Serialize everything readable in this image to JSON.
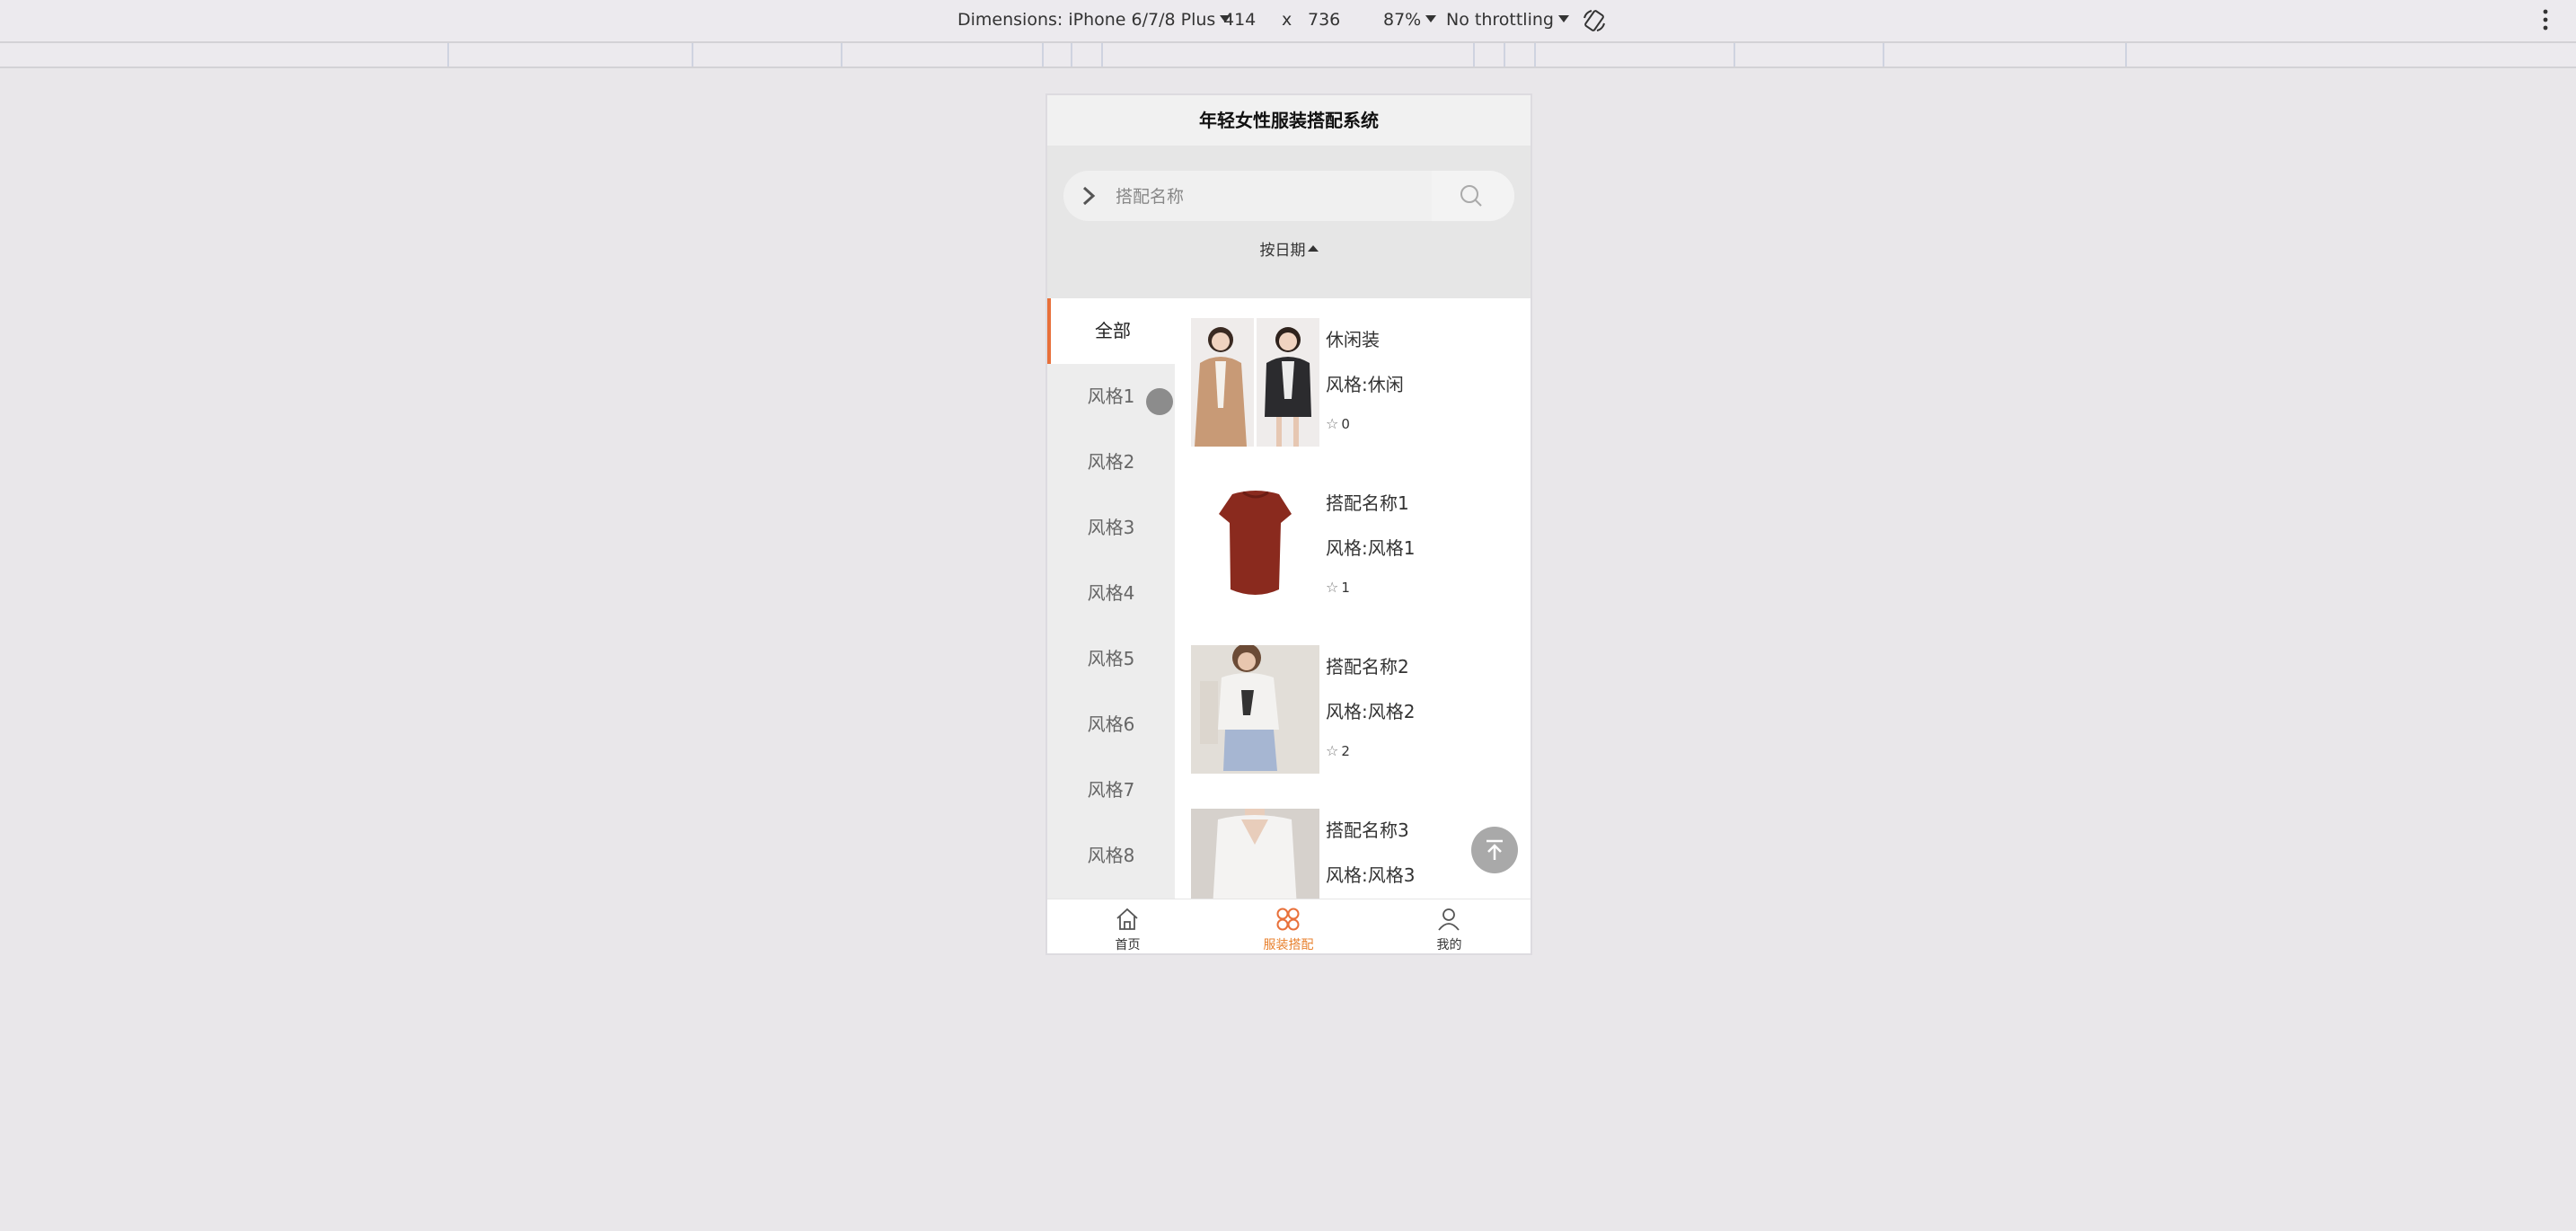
{
  "devtools": {
    "dimensions_label": "Dimensions: iPhone 6/7/8 Plus",
    "width": "414",
    "times": "x",
    "height": "736",
    "zoom": "87%",
    "throttling": "No throttling"
  },
  "app": {
    "title": "年轻女性服装搭配系统",
    "search": {
      "placeholder": "搭配名称",
      "value": ""
    },
    "sort_label": "按日期",
    "categories": [
      "全部",
      "风格1",
      "风格2",
      "风格3",
      "风格4",
      "风格5",
      "风格6",
      "风格7",
      "风格8"
    ],
    "active_category": "全部",
    "products": [
      {
        "name": "休闲装",
        "style": "风格:休闲",
        "likes": "0"
      },
      {
        "name": "搭配名称1",
        "style": "风格:风格1",
        "likes": "1"
      },
      {
        "name": "搭配名称2",
        "style": "风格:风格2",
        "likes": "2"
      },
      {
        "name": "搭配名称3",
        "style": "风格:风格3",
        "likes": ""
      }
    ],
    "tabs": [
      {
        "label": "首页",
        "icon": "home-icon"
      },
      {
        "label": "服装搭配",
        "icon": "clover-icon"
      },
      {
        "label": "我的",
        "icon": "user-icon"
      }
    ],
    "accent_color": "#e8703a"
  }
}
